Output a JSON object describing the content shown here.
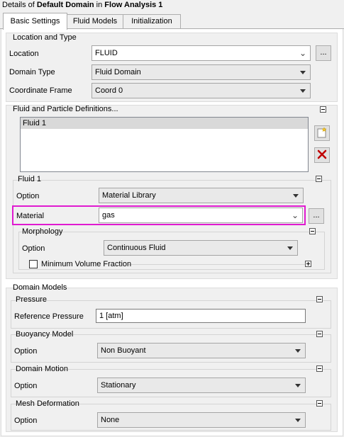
{
  "window": {
    "title_prefix": "Details of ",
    "domain_name": "Default Domain",
    "title_middle": " in ",
    "analysis_name": "Flow Analysis 1"
  },
  "tabs": [
    {
      "label": "Basic Settings",
      "active": true
    },
    {
      "label": "Fluid Models",
      "active": false
    },
    {
      "label": "Initialization",
      "active": false
    }
  ],
  "location_type": {
    "title": "Location and Type",
    "location_label": "Location",
    "location_value": "FLUID",
    "location_button": "...",
    "domain_type_label": "Domain Type",
    "domain_type_value": "Fluid Domain",
    "coord_frame_label": "Coordinate Frame",
    "coord_frame_value": "Coord 0"
  },
  "fluid_defs": {
    "title": "Fluid and Particle Definitions...",
    "items": [
      "Fluid 1"
    ],
    "fluid1": {
      "title": "Fluid 1",
      "option_label": "Option",
      "option_value": "Material Library",
      "material_label": "Material",
      "material_value": "gas",
      "material_button": "...",
      "morphology": {
        "title": "Morphology",
        "option_label": "Option",
        "option_value": "Continuous Fluid",
        "min_volume_fraction_label": "Minimum Volume Fraction",
        "min_volume_fraction_checked": false
      }
    }
  },
  "domain_models": {
    "title": "Domain Models",
    "pressure": {
      "title": "Pressure",
      "ref_label": "Reference Pressure",
      "ref_value": "1 [atm]"
    },
    "buoyancy": {
      "title": "Buoyancy Model",
      "option_label": "Option",
      "option_value": "Non Buoyant"
    },
    "motion": {
      "title": "Domain Motion",
      "option_label": "Option",
      "option_value": "Stationary"
    },
    "mesh": {
      "title": "Mesh Deformation",
      "option_label": "Option",
      "option_value": "None"
    }
  },
  "colors": {
    "highlight": "#e01ad0",
    "delete_icon": "#c00000"
  }
}
